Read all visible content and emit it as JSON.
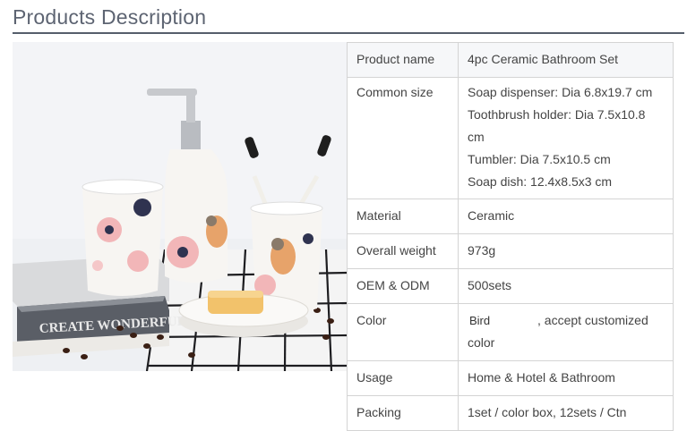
{
  "header": {
    "title": "Products Description"
  },
  "photo": {
    "book_text": "CREATE WONDERFUL HOME",
    "colors": {
      "background": "#eef0f3",
      "ceramic": "#f7f5f2",
      "flower_pink": "#f2b6b8",
      "flower_dark": "#2f3350",
      "soap": "#f2c26b",
      "book": "#5a5e66",
      "pump": "#b9bcc1"
    }
  },
  "table": {
    "product_name": {
      "label": "Product name",
      "value": "4pc Ceramic Bathroom Set"
    },
    "common_size": {
      "label": "Common size",
      "lines": [
        "Soap dispenser: Dia 6.8x19.7 cm",
        "Toothbrush holder: Dia 7.5x10.8 cm",
        "Tumbler: Dia 7.5x10.5 cm",
        "Soap dish: 12.4x8.5x3 cm"
      ]
    },
    "material": {
      "label": "Material",
      "value": "Ceramic"
    },
    "weight": {
      "label": "Overall weight",
      "value": "973g"
    },
    "oem": {
      "label": "OEM & ODM",
      "value": "500sets"
    },
    "color": {
      "label": "Color",
      "swatch": "Bird",
      "value": ", accept customized color"
    },
    "usage": {
      "label": "Usage",
      "value": "Home & Hotel & Bathroom"
    },
    "packing": {
      "label": "Packing",
      "value": "1set / color box, 12sets / Ctn"
    }
  }
}
